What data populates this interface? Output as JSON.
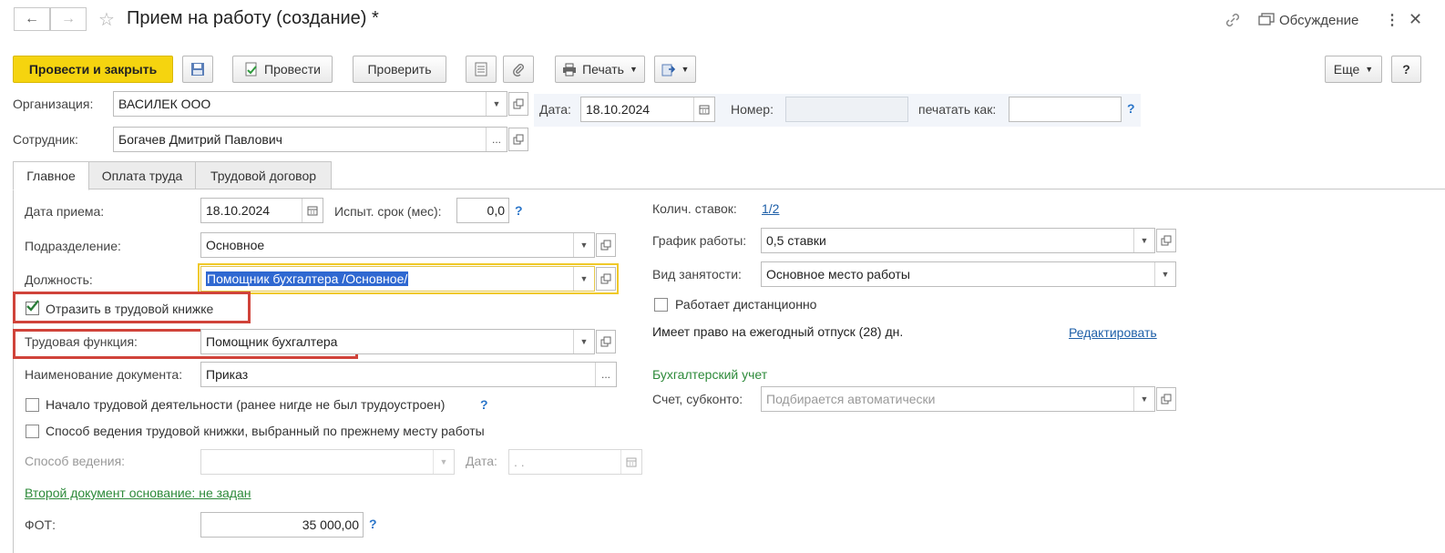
{
  "window": {
    "title": "Прием на работу (создание) *",
    "discussion_label": "Обсуждение"
  },
  "toolbar": {
    "post_close": "Провести и закрыть",
    "post": "Провести",
    "check": "Проверить",
    "print": "Печать",
    "more": "Еще",
    "help": "?"
  },
  "header": {
    "org_label": "Организация:",
    "org_value": "ВАСИЛЕК ООО",
    "date_label": "Дата:",
    "date_value": "18.10.2024",
    "number_label": "Номер:",
    "number_value": "",
    "print_as_label": "печатать как:",
    "print_as_value": "",
    "help": "?",
    "employee_label": "Сотрудник:",
    "employee_value": "Богачев Дмитрий Павлович"
  },
  "tabs": [
    {
      "label": "Главное",
      "active": true
    },
    {
      "label": "Оплата труда",
      "active": false
    },
    {
      "label": "Трудовой договор",
      "active": false
    }
  ],
  "main": {
    "hire_date_label": "Дата приема:",
    "hire_date_value": "18.10.2024",
    "probation_label": "Испыт. срок (мес):",
    "probation_value": "0,0",
    "division_label": "Подразделение:",
    "division_value": "Основное",
    "position_label": "Должность:",
    "position_value": "Помощник бухгалтера /Основное/",
    "reflect_label": "Отразить в трудовой книжке",
    "reflect_checked": true,
    "labor_function_label": "Трудовая функция:",
    "labor_function_value": "Помощник бухгалтера",
    "doc_name_label": "Наименование документа:",
    "doc_name_value": "Приказ",
    "start_activity_label": "Начало трудовой деятельности (ранее нигде не был трудоустроен)",
    "workbook_method_label": "Способ ведения трудовой книжки, выбранный по прежнему месту работы",
    "method_label": "Способ ведения:",
    "method_date_label": "Дата:",
    "method_date_value": "  .  .",
    "second_doc_link": "Второй документ основание: не задан",
    "fot_label": "ФОТ:",
    "fot_value": "35 000,00",
    "help": "?"
  },
  "right": {
    "rates_label": "Колич. ставок:",
    "rates_value": "1/2",
    "schedule_label": "График работы:",
    "schedule_value": "0,5 ставки",
    "employment_label": "Вид занятости:",
    "employment_value": "Основное место работы",
    "remote_label": "Работает дистанционно",
    "vacation_text": "Имеет право на ежегодный отпуск (28) дн.",
    "edit_link": "Редактировать",
    "accounting_header": "Бухгалтерский учет",
    "account_label": "Счет, субконто:",
    "account_placeholder": "Подбирается автоматически"
  },
  "colors": {
    "primary_button": "#f5d40f",
    "highlight_box": "#d0433a",
    "link": "#1e5fa8",
    "green_link": "#2d8a3a"
  }
}
